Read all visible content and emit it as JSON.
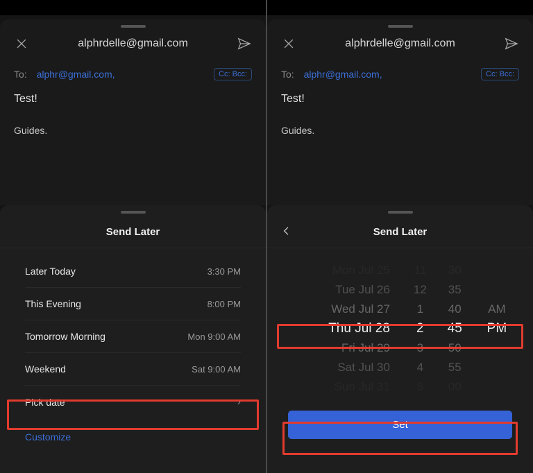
{
  "header": {
    "from": "alphrdelle@gmail.com",
    "to_label": "To:",
    "to_email": "alphr@gmail.com,",
    "ccbcc": "Cc: Bcc:",
    "subject": "Test!",
    "body": "Guides."
  },
  "sheet_left": {
    "title": "Send Later",
    "options": [
      {
        "label": "Later Today",
        "value": "3:30 PM"
      },
      {
        "label": "This Evening",
        "value": "8:00 PM"
      },
      {
        "label": "Tomorrow Morning",
        "value": "Mon 9:00 AM"
      },
      {
        "label": "Weekend",
        "value": "Sat 9:00 AM"
      }
    ],
    "pick": "Pick date",
    "customize": "Customize"
  },
  "sheet_right": {
    "title": "Send Later",
    "dates": [
      "Mon Jul 25",
      "Tue Jul 26",
      "Wed Jul 27",
      "Thu Jul 28",
      "Fri Jul 29",
      "Sat Jul 30",
      "Sun Jul 31"
    ],
    "hours": [
      "11",
      "12",
      "1",
      "2",
      "3",
      "4",
      "5"
    ],
    "mins": [
      "30",
      "35",
      "40",
      "45",
      "50",
      "55",
      "00"
    ],
    "ampm": [
      "",
      "",
      "AM",
      "PM",
      "",
      "",
      ""
    ],
    "set": "Set"
  }
}
